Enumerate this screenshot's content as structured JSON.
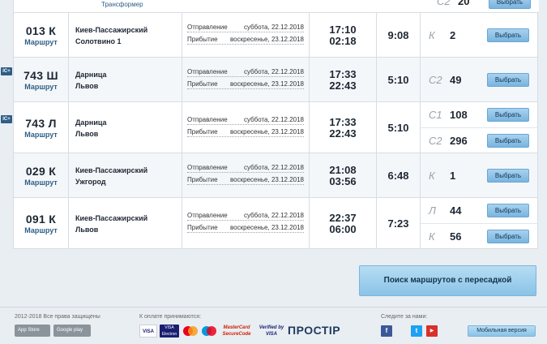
{
  "top": {
    "partial_label": "Трансформер",
    "partial_class": "С2",
    "partial_count": "20",
    "partial_button": "Выбрать"
  },
  "trains": [
    {
      "ic": false,
      "number": "013 К",
      "route_label": "Маршрут",
      "from": "Киев-Пассажирский",
      "to": "Солотвино 1",
      "dep_label": "Отправление",
      "dep_date": "суббота, 22.12.2018",
      "arr_label": "Прибытие",
      "arr_date": "воскресенье, 23.12.2018",
      "dep_time": "17:10",
      "arr_time": "02:18",
      "duration": "9:08",
      "seats": [
        {
          "cls": "К",
          "count": "2",
          "button": "Выбрать"
        }
      ]
    },
    {
      "ic": true,
      "ic_label": "IC+",
      "number": "743 Ш",
      "route_label": "Маршрут",
      "from": "Дарница",
      "to": "Львов",
      "dep_label": "Отправление",
      "dep_date": "суббота, 22.12.2018",
      "arr_label": "Прибытие",
      "arr_date": "воскресенье, 23.12.2018",
      "dep_time": "17:33",
      "arr_time": "22:43",
      "duration": "5:10",
      "seats": [
        {
          "cls": "С2",
          "count": "49",
          "button": "Выбрать"
        }
      ]
    },
    {
      "ic": true,
      "ic_label": "IC+",
      "number": "743 Л",
      "route_label": "Маршрут",
      "from": "Дарница",
      "to": "Львов",
      "dep_label": "Отправление",
      "dep_date": "суббота, 22.12.2018",
      "arr_label": "Прибытие",
      "arr_date": "воскресенье, 23.12.2018",
      "dep_time": "17:33",
      "arr_time": "22:43",
      "duration": "5:10",
      "seats": [
        {
          "cls": "С1",
          "count": "108",
          "button": "Выбрать"
        },
        {
          "cls": "С2",
          "count": "296",
          "button": "Выбрать"
        }
      ]
    },
    {
      "ic": false,
      "number": "029 К",
      "route_label": "Маршрут",
      "from": "Киев-Пассажирский",
      "to": "Ужгород",
      "dep_label": "Отправление",
      "dep_date": "суббота, 22.12.2018",
      "arr_label": "Прибытие",
      "arr_date": "воскресенье, 23.12.2018",
      "dep_time": "21:08",
      "arr_time": "03:56",
      "duration": "6:48",
      "seats": [
        {
          "cls": "К",
          "count": "1",
          "button": "Выбрать"
        }
      ]
    },
    {
      "ic": false,
      "number": "091 К",
      "route_label": "Маршрут",
      "from": "Киев-Пассажирский",
      "to": "Львов",
      "dep_label": "Отправление",
      "dep_date": "суббота, 22.12.2018",
      "arr_label": "Прибытие",
      "arr_date": "воскресенье, 23.12.2018",
      "dep_time": "22:37",
      "arr_time": "06:00",
      "duration": "7:23",
      "seats": [
        {
          "cls": "Л",
          "count": "44",
          "button": "Выбрать"
        },
        {
          "cls": "К",
          "count": "56",
          "button": "Выбрать"
        }
      ]
    }
  ],
  "search_transfer": "Поиск маршрутов с пересадкой",
  "footer": {
    "copyright": "2012-2018 Все права защищены",
    "app_store": "App Store",
    "google_play": "Google play",
    "payment_title": "К оплате принимаются:",
    "visa": "VISA",
    "visa_electron": "VISA Electron",
    "mastercard_securecode": "MasterCard SecureCode",
    "verified_visa": "Verified by VISA",
    "prostir": "ПРОСТІР",
    "follow_title": "Следите за нами:",
    "mobile_version": "Мобильная версия"
  },
  "colors": {
    "accent": "#79b4df",
    "brand_dark": "#2f5d86",
    "facebook": "#3b5998",
    "twitter": "#1da1f2",
    "youtube": "#d9302c"
  }
}
